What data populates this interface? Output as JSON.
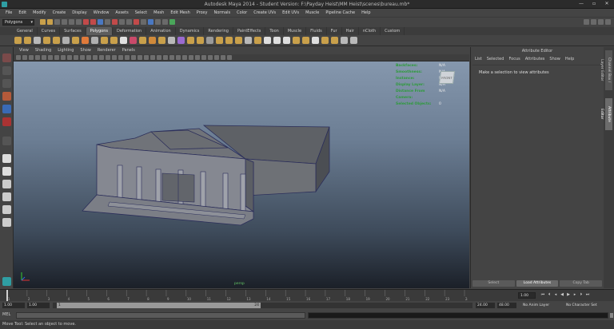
{
  "window": {
    "title": "Autodesk Maya 2014 - Student Version: F:\\Payday Heist\\MM Heist\\scenes\\bureau.mb*"
  },
  "menubar": [
    "File",
    "Edit",
    "Modify",
    "Create",
    "Display",
    "Window",
    "Assets",
    "Select",
    "Mesh",
    "Edit Mesh",
    "Proxy",
    "Normals",
    "Color",
    "Create UVs",
    "Edit UVs",
    "Muscle",
    "Pipeline Cache",
    "Help"
  ],
  "status_line": {
    "mode": "Polygons"
  },
  "shelf_tabs": [
    "General",
    "Curves",
    "Surfaces",
    "Polygons",
    "Deformation",
    "Animation",
    "Dynamics",
    "Rendering",
    "PaintEffects",
    "Toon",
    "Muscle",
    "Fluids",
    "Fur",
    "Hair",
    "nCloth",
    "Custom"
  ],
  "shelf_active_tab": "Polygons",
  "panel_menu": [
    "View",
    "Shading",
    "Lighting",
    "Show",
    "Renderer",
    "Panels"
  ],
  "hud": [
    {
      "label": "Backfaces:",
      "value": "N/A"
    },
    {
      "label": "Smoothness:",
      "value": "N/A"
    },
    {
      "label": "Instance:",
      "value": "N/A"
    },
    {
      "label": "Display Layer:",
      "value": "N/A"
    },
    {
      "label": "Distance From Camera:",
      "value": "N/A"
    },
    {
      "label": "Selected Objects:",
      "value": "0"
    }
  ],
  "viewcube_label": "FRONT",
  "viewport_label": "persp",
  "attribute_editor": {
    "title": "Attribute Editor",
    "menu": [
      "List",
      "Selected",
      "Focus",
      "Attributes",
      "Show",
      "Help"
    ],
    "message": "Make a selection to view attributes",
    "buttons": [
      "Select",
      "Load Attributes",
      "Copy Tab"
    ]
  },
  "side_tabs": [
    "Channel Box / Layer Editor",
    "Attribute Editor"
  ],
  "time_slider": {
    "ticks": [
      "1",
      "2",
      "3",
      "4",
      "5",
      "6",
      "7",
      "8",
      "9",
      "10",
      "11",
      "12",
      "13",
      "14",
      "15",
      "16",
      "17",
      "18",
      "19",
      "20",
      "21",
      "22",
      "23",
      "24"
    ],
    "current_time": "1.00"
  },
  "range_slider": {
    "start": "1.00",
    "inner_start": "1.00",
    "handle_start": "1",
    "handle_end": "24",
    "end_time": "24.00",
    "anim_end": "48.00",
    "anim_layer": "No Anim Layer",
    "char_set": "No Character Set"
  },
  "command_line": {
    "label": "MEL"
  },
  "help_line": "Move Tool: Select an object to move."
}
